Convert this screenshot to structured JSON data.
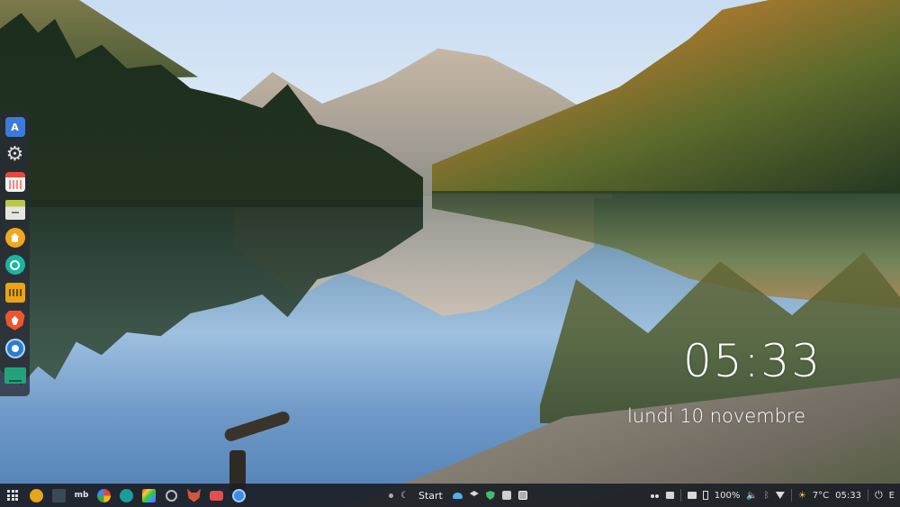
{
  "clock": {
    "time": "05:33",
    "date": "lundi 10 novembre"
  },
  "dock": {
    "items": [
      {
        "name": "translate",
        "icon": "translate-icon"
      },
      {
        "name": "settings",
        "icon": "gear-icon"
      },
      {
        "name": "calendar",
        "icon": "calendar-icon"
      },
      {
        "name": "files",
        "icon": "files-icon"
      },
      {
        "name": "home",
        "icon": "home-icon"
      },
      {
        "name": "aperture",
        "icon": "aperture-icon"
      },
      {
        "name": "radio",
        "icon": "radio-icon"
      },
      {
        "name": "brave",
        "icon": "brave-lion-icon"
      },
      {
        "name": "dbeaver",
        "icon": "database-icon"
      },
      {
        "name": "monitor",
        "icon": "monitor-icon"
      }
    ],
    "translate_glyph": "A"
  },
  "taskbar": {
    "start_label": "Start",
    "mb_label": "mb",
    "battery_percent": "100%",
    "temperature": "7°C",
    "time": "05:33",
    "kbd_label": "E"
  }
}
